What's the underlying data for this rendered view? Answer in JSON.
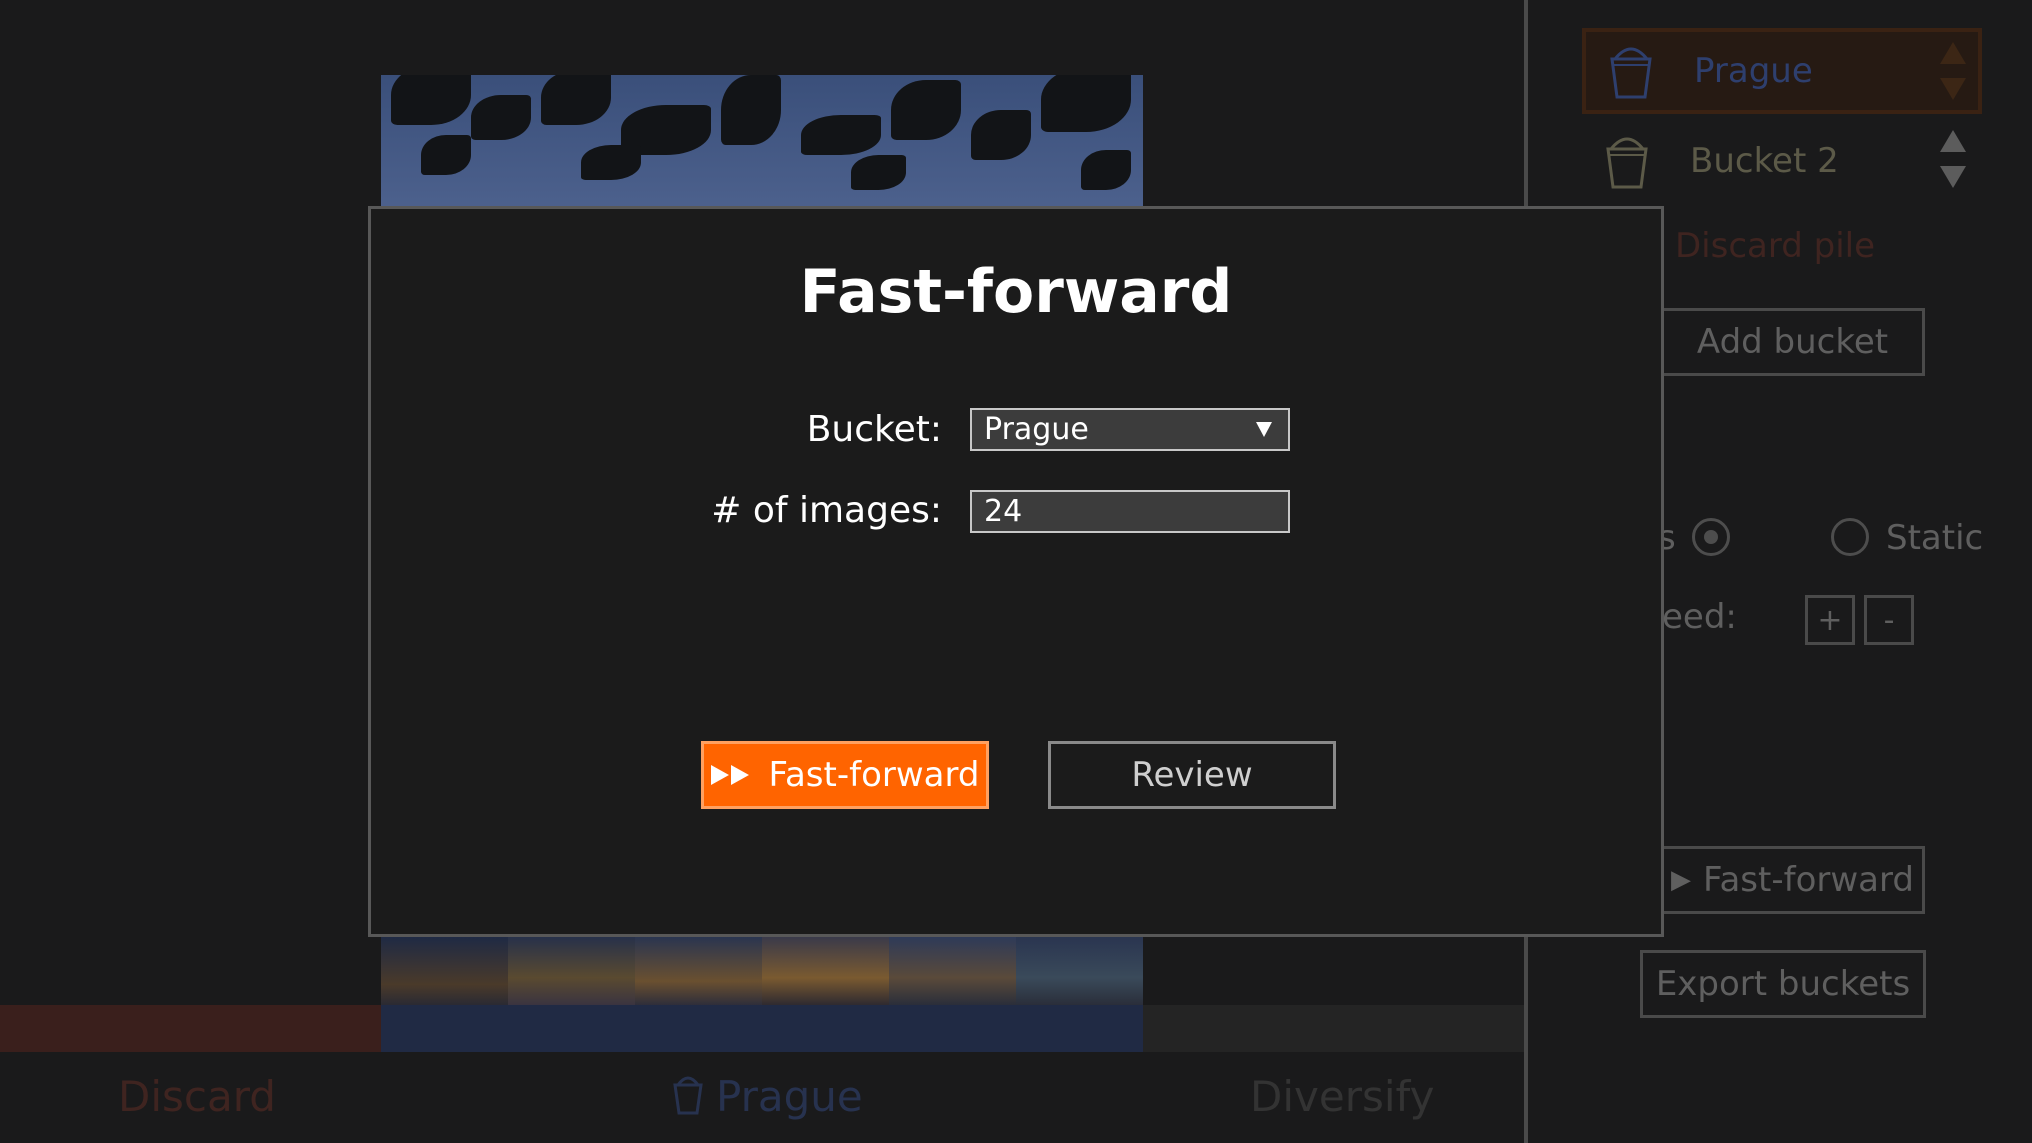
{
  "main": {
    "bottom": {
      "discard_label": "Discard",
      "bucket_label": "Prague",
      "diversify_label": "Diversify"
    }
  },
  "sidebar": {
    "buckets": [
      {
        "label": "Prague",
        "selected": true,
        "color": "#2e3f6e"
      },
      {
        "label": "Bucket 2",
        "selected": false,
        "color": "#5c5a48"
      }
    ],
    "discard_pile_label": "Discard pile",
    "add_bucket_label": "Add bucket",
    "mode_radio_partial_label": "s",
    "static_label": "Static",
    "speed_partial_label": "eed:",
    "speed_plus": "+",
    "speed_minus": "-",
    "fast_forward_label": "Fast-forward",
    "export_label": "Export buckets"
  },
  "modal": {
    "title": "Fast-forward",
    "bucket_label": "Bucket:",
    "bucket_value": "Prague",
    "images_label": "# of images:",
    "images_value": "24",
    "fast_forward_button": "Fast-forward",
    "review_button": "Review"
  },
  "colors": {
    "accent": "#ff6400",
    "discard": "#3a1f1c",
    "bucket_bar": "#202a44"
  }
}
